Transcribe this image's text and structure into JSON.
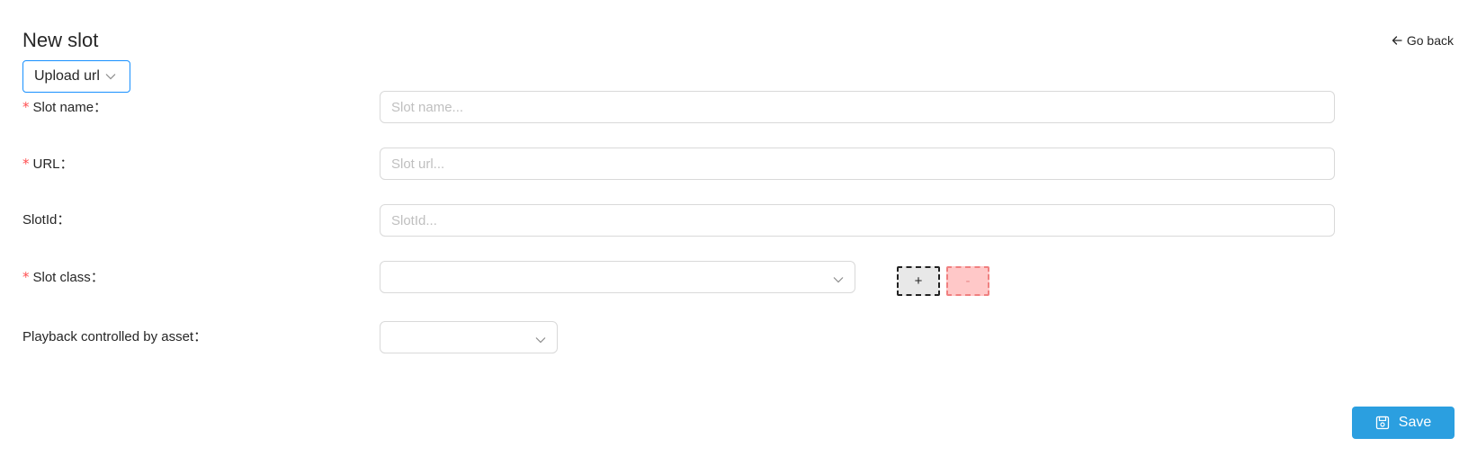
{
  "header": {
    "title": "New slot",
    "go_back_label": "Go back"
  },
  "mode_select": {
    "value": "Upload url"
  },
  "form": {
    "slot_name": {
      "label": "Slot name：",
      "required": true,
      "value": "",
      "placeholder": "Slot name..."
    },
    "url": {
      "label": "URL：",
      "required": true,
      "value": "",
      "placeholder": "Slot url..."
    },
    "slot_id": {
      "label": "SlotId：",
      "required": false,
      "value": "",
      "placeholder": "SlotId..."
    },
    "slot_class": {
      "label": "Slot class：",
      "required": true,
      "value": "",
      "add_label": "+",
      "remove_label": "-"
    },
    "playback": {
      "label": "Playback controlled by asset：",
      "required": false,
      "value": ""
    },
    "required_marker": "*"
  },
  "footer": {
    "save_label": "Save"
  },
  "icons": {
    "back": "arrow-left-icon",
    "dropdown": "chevron-down-icon",
    "save": "save-icon"
  },
  "colors": {
    "primary": "#2b9fe0",
    "required": "#ff4d4f",
    "border": "#d9d9d9",
    "placeholder": "#bfbfbf",
    "remove_bg": "#ffc8c8"
  }
}
